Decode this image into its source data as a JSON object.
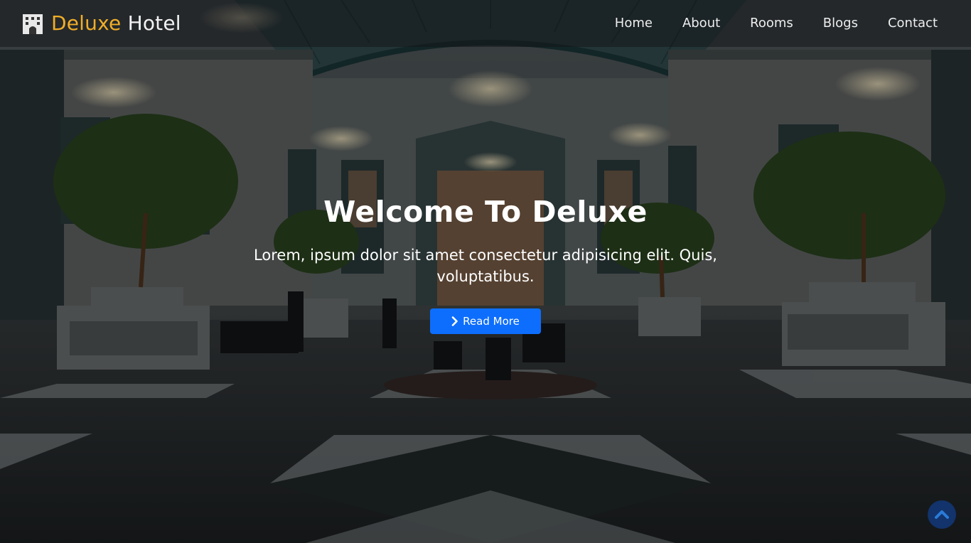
{
  "brand": {
    "accent": "Deluxe",
    "rest": "Hotel",
    "icon": "hotel-building-icon",
    "accent_color": "#f0ad28"
  },
  "nav": {
    "items": [
      {
        "label": "Home"
      },
      {
        "label": "About"
      },
      {
        "label": "Rooms"
      },
      {
        "label": "Blogs"
      },
      {
        "label": "Contact"
      }
    ]
  },
  "hero": {
    "title": "Welcome To Deluxe",
    "subtitle": "Lorem, ipsum dolor sit amet consectetur adipisicing elit. Quis, voluptatibus.",
    "cta_label": "Read More",
    "cta_icon": "chevron-right-icon",
    "cta_color": "#0d6efd"
  },
  "scroll_top": {
    "icon": "chevron-up-icon",
    "color": "#12336b"
  }
}
